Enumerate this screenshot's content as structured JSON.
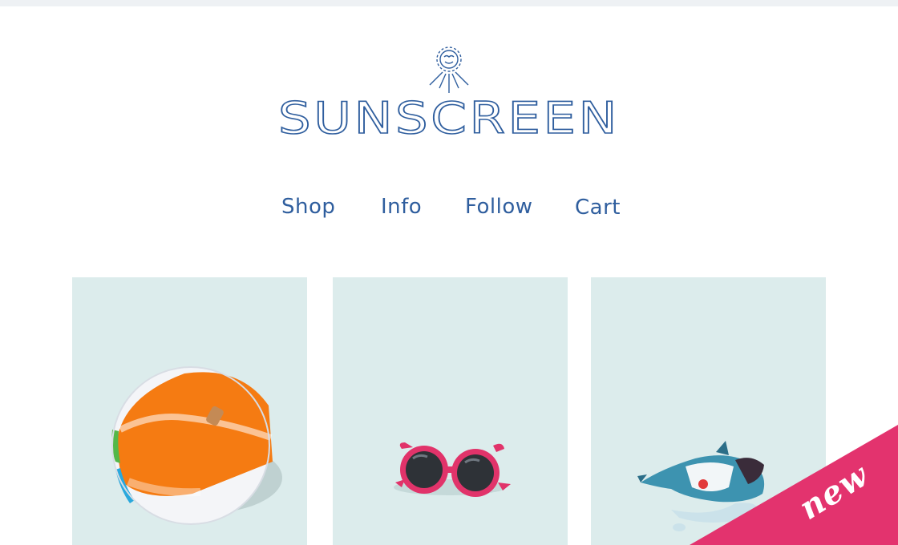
{
  "brand": {
    "name": "SUNSCREEN",
    "logo_icon": "sun-face-icon",
    "color": "#2f5e9e"
  },
  "nav": {
    "items": [
      {
        "label": "Shop"
      },
      {
        "label": "Info"
      },
      {
        "label": "Follow"
      },
      {
        "label": "Cart"
      }
    ]
  },
  "products": [
    {
      "image": "beach-ball",
      "bg_color": "#dcecec"
    },
    {
      "image": "pink-sunglasses",
      "bg_color": "#dcecec"
    },
    {
      "image": "dolphin-toy",
      "bg_color": "#dcecec"
    }
  ],
  "badge": {
    "label": "new",
    "color": "#e3336e"
  }
}
